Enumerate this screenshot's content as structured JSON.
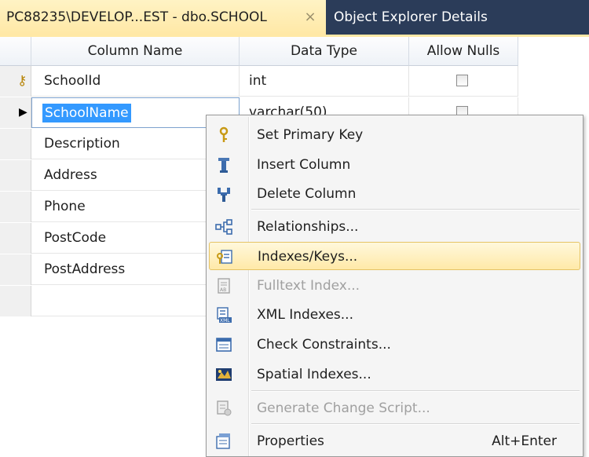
{
  "tabs": [
    {
      "label": "PC88235\\DEVELOP...EST - dbo.SCHOOL",
      "active": true,
      "close": "×"
    },
    {
      "label": "Object Explorer Details",
      "active": false
    }
  ],
  "grid": {
    "headers": {
      "name": "Column Name",
      "type": "Data Type",
      "nulls": "Allow Nulls"
    },
    "rows": [
      {
        "name": "SchoolId",
        "type": "int",
        "allow_nulls": false,
        "primary_key": true
      },
      {
        "name": "SchoolName",
        "type": "varchar(50)",
        "allow_nulls": false,
        "selected": true
      },
      {
        "name": "Description",
        "type": "",
        "allow_nulls": false
      },
      {
        "name": "Address",
        "type": "",
        "allow_nulls": false
      },
      {
        "name": "Phone",
        "type": "",
        "allow_nulls": false
      },
      {
        "name": "PostCode",
        "type": "",
        "allow_nulls": false
      },
      {
        "name": "PostAddress",
        "type": "",
        "allow_nulls": false
      },
      {
        "name": "",
        "type": "",
        "allow_nulls": false
      }
    ],
    "row_indicator": "▶"
  },
  "context_menu": {
    "items": [
      {
        "label": "Set Primary Key",
        "icon": "key-icon",
        "disabled": false
      },
      {
        "label": "Insert Column",
        "icon": "insert-column-icon",
        "disabled": false
      },
      {
        "label": "Delete Column",
        "icon": "delete-column-icon",
        "disabled": false
      },
      {
        "label": "Relationships...",
        "icon": "relationships-icon",
        "disabled": false
      },
      {
        "label": "Indexes/Keys...",
        "icon": "indexes-keys-icon",
        "disabled": false,
        "hover": true
      },
      {
        "label": "Fulltext Index...",
        "icon": "fulltext-index-icon",
        "disabled": true
      },
      {
        "label": "XML Indexes...",
        "icon": "xml-indexes-icon",
        "disabled": false
      },
      {
        "label": "Check Constraints...",
        "icon": "check-constraints-icon",
        "disabled": false
      },
      {
        "label": "Spatial Indexes...",
        "icon": "spatial-indexes-icon",
        "disabled": false
      },
      {
        "label": "Generate Change Script...",
        "icon": "generate-script-icon",
        "disabled": true
      },
      {
        "label": "Properties",
        "icon": "properties-icon",
        "disabled": false,
        "shortcut": "Alt+Enter"
      }
    ]
  },
  "colors": {
    "tab_bar": "#2b3c59",
    "tab_active": "#ffe8a6",
    "selection": "#3399ff",
    "menu_hover": "#ffe9a8"
  }
}
